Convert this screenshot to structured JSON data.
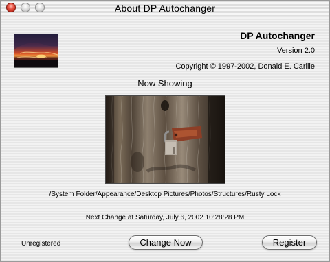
{
  "window": {
    "title": "About DP Autochanger"
  },
  "header": {
    "app_name": "DP Autochanger",
    "version": "Version 2.0",
    "copyright": "Copyright © 1997-2002, Donald E. Carlile"
  },
  "preview": {
    "heading": "Now Showing",
    "path": "/System Folder/Appearance/Desktop Pictures/Photos/Structures/Rusty Lock"
  },
  "schedule": {
    "next_change": "Next Change at Saturday, July 6, 2002 10:28:28 PM"
  },
  "footer": {
    "status": "Unregistered",
    "change_label": "Change Now",
    "register_label": "Register"
  }
}
